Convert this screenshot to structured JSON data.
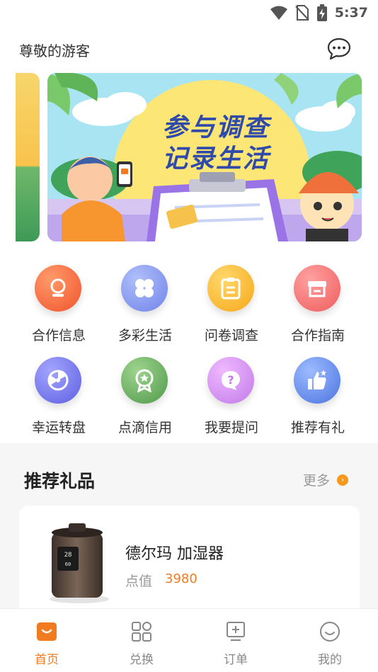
{
  "status": {
    "time": "5:37"
  },
  "header": {
    "greeting": "尊敬的游客"
  },
  "banner": {
    "line1": "参与调查",
    "line2": "记录生活"
  },
  "grid": [
    {
      "label": "合作信息",
      "icon": "cooperation-info-icon",
      "color": "#f4633a"
    },
    {
      "label": "多彩生活",
      "icon": "colorful-life-icon",
      "color": "#7a8df0"
    },
    {
      "label": "问卷调查",
      "icon": "survey-icon",
      "color": "#f8b324"
    },
    {
      "label": "合作指南",
      "icon": "guide-icon",
      "color": "#f26d6d"
    },
    {
      "label": "幸运转盘",
      "icon": "lucky-wheel-icon",
      "color": "#6f71e8"
    },
    {
      "label": "点滴信用",
      "icon": "credit-icon",
      "color": "#5fa85a"
    },
    {
      "label": "我要提问",
      "icon": "question-icon",
      "color": "#c884e8"
    },
    {
      "label": "推荐有礼",
      "icon": "recommend-icon",
      "color": "#5a86e8"
    }
  ],
  "section": {
    "title": "推荐礼品",
    "more": "更多"
  },
  "gift": {
    "name": "德尔玛 加湿器",
    "points_label": "点值",
    "points": "3980"
  },
  "tabs": [
    {
      "label": "首页",
      "icon": "home-icon",
      "active": true
    },
    {
      "label": "兑换",
      "icon": "exchange-icon",
      "active": false
    },
    {
      "label": "订单",
      "icon": "order-icon",
      "active": false
    },
    {
      "label": "我的",
      "icon": "profile-icon",
      "active": false
    }
  ],
  "colors": {
    "accent": "#f07b21",
    "banner_text": "#2f4aa8"
  }
}
